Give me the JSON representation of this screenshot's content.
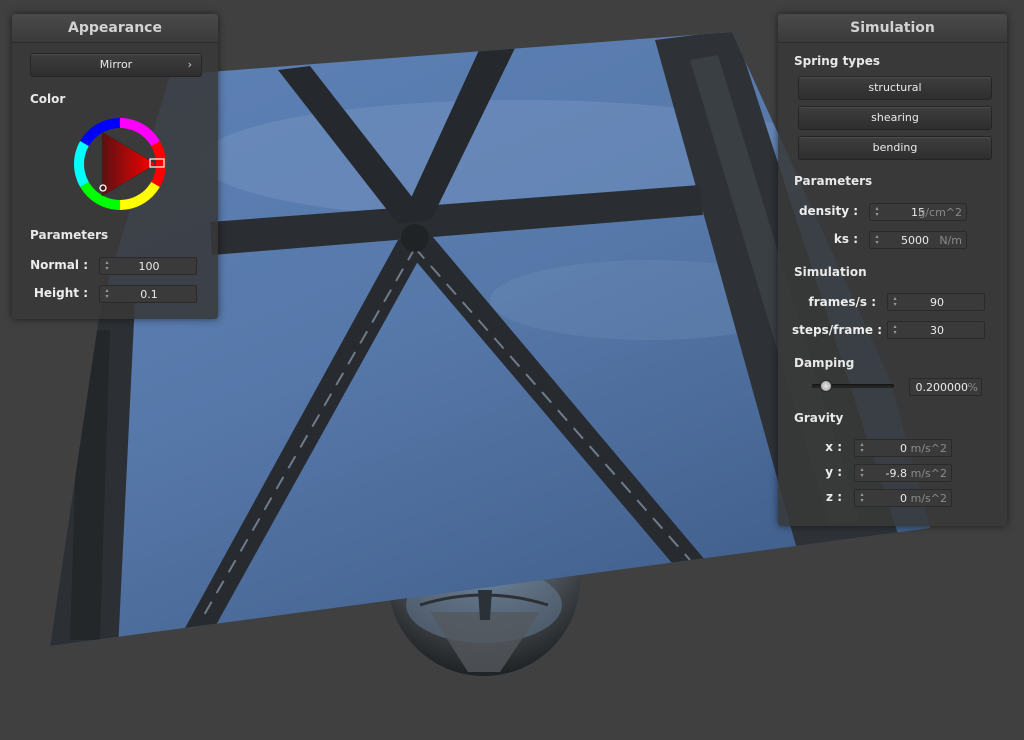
{
  "appearance": {
    "title": "Appearance",
    "shader_button": "Mirror",
    "color_label": "Color",
    "params_label": "Parameters",
    "normal_label": "Normal :",
    "normal_value": "100",
    "height_label": "Height :",
    "height_value": "0.1"
  },
  "simulation": {
    "title": "Simulation",
    "spring_types_label": "Spring types",
    "springs": [
      "structural",
      "shearing",
      "bending"
    ],
    "params_label": "Parameters",
    "density_label": "density :",
    "density_value": "15",
    "density_unit": "g/cm^2",
    "ks_label": "ks :",
    "ks_value": "5000",
    "ks_unit": "N/m",
    "sim_label": "Simulation",
    "fps_label": "frames/s :",
    "fps_value": "90",
    "steps_label": "steps/frame :",
    "steps_value": "30",
    "damping_label": "Damping",
    "damping_value": "0.200000",
    "damping_unit": "%",
    "damping_fraction": 0.2,
    "gravity_label": "Gravity",
    "gx_label": "x :",
    "gx_value": "0",
    "gy_label": "y :",
    "gy_value": "-9.8",
    "gz_label": "z :",
    "gz_value": "0",
    "gravity_unit": "m/s^2"
  },
  "colors": {
    "background": "#404040",
    "picked_color": "#c00000"
  }
}
